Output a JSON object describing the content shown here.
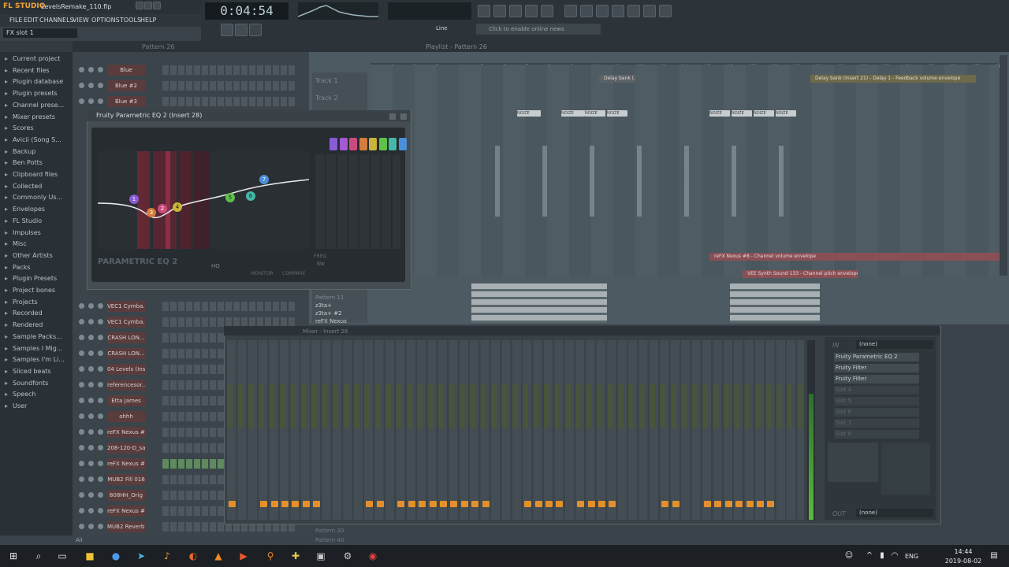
{
  "app": {
    "logo": "FL STUDIO",
    "filename": "LevelsRemake_110.flp",
    "hint": "FX slot 1"
  },
  "menu": [
    {
      "id": "file",
      "label": "FILE"
    },
    {
      "id": "edit",
      "label": "EDIT"
    },
    {
      "id": "channels",
      "label": "CHANNELS"
    },
    {
      "id": "view",
      "label": "VIEW"
    },
    {
      "id": "options",
      "label": "OPTIONS"
    },
    {
      "id": "tools",
      "label": "TOOLS"
    },
    {
      "id": "help",
      "label": "HELP"
    }
  ],
  "transport": {
    "time": "0:04:54",
    "snap": "Line",
    "news": "Click to enable online news"
  },
  "browser": {
    "items": [
      "Current project",
      "Recent files",
      "Plugin database",
      "Plugin presets",
      "Channel prese...",
      "Mixer presets",
      "Scores",
      "Avicii (Song S...",
      "Backup",
      "Ben Potts",
      "Clipboard files",
      "Collected",
      "Commonly Us...",
      "Envelopes",
      "FL Studio",
      "Impulses",
      "Misc",
      "Other Artists",
      "Packs",
      "Plugin Presets",
      "Project bones",
      "Projects",
      "Recorded",
      "Rendered",
      "Sample Packs...",
      "Samples I Mig...",
      "Samples I'm Li...",
      "Sliced beats",
      "Soundfonts",
      "Speech",
      "User"
    ],
    "footer": "All"
  },
  "rack": {
    "title": "Pattern 26",
    "filter": "All",
    "channels": [
      "Blue",
      "Blue #2",
      "Blue #3",
      "VEC1 Cymba...",
      "VEC1 Cymba...",
      "CRASH LON...",
      "CRASH LON...",
      "04 Levels (Ins...",
      "referencesor...",
      "Etta James",
      "ohhh",
      "reFX Nexus #7",
      "208-120-D_sa...",
      "reFX Nexus #8",
      "MUB2 Fill 016",
      "808HH_Orig",
      "reFX Nexus #6",
      "MUB2 Reverb..."
    ]
  },
  "playlist": {
    "title": "Playlist - Pattern 26",
    "tracks": [
      "Track 1",
      "Track 2"
    ],
    "lower_tracks": [
      "Pattern 11",
      "z3ta+",
      "z3ta+ #2",
      "reFX Nexus"
    ],
    "bottom_tracks": [
      "Pattern 30",
      "Pattern 40"
    ],
    "clips": {
      "delay1": "Delay bank (...",
      "delay2": "Delay bank (Insert 21) - Delay 1 - Feedback volume envelope",
      "noize": "NOIZE",
      "nexus_env": "reFX Nexus #8 - Channel volume envelope",
      "vee_env": "VEE Synth Sound 133 - Channel pitch envelope"
    },
    "ruler": [
      "1",
      "2",
      "3",
      "4",
      "5",
      "6",
      "7",
      "8",
      "9",
      "10",
      "11",
      "12",
      "13",
      "14",
      "15",
      "16",
      "17",
      "18",
      "19",
      "20",
      "21",
      "22",
      "23",
      "24",
      "25",
      "26",
      "27",
      "28"
    ]
  },
  "eq": {
    "title": "Fruity Parametric EQ 2 (Insert 28)",
    "label": "PARAMETRIC EQ 2",
    "hq": "HQ",
    "monitor": "MONITOR",
    "compare": "COMPARE",
    "freq": "FREQ",
    "bw": "BW",
    "bands": [
      "1",
      "2",
      "3",
      "4",
      "5",
      "6",
      "7"
    ],
    "band_colors": [
      "#8a5bd6",
      "#a45ad3",
      "#cc4b7f",
      "#d47d3e",
      "#c8b53a",
      "#5ec24a",
      "#45b8a9",
      "#4a8fd8"
    ]
  },
  "mixer": {
    "title": "Mixer - Insert 28",
    "in_label": "IN",
    "in_value": "(none)",
    "out_label": "OUT",
    "out_value": "(none)",
    "slots": [
      "Fruity Parametric EQ 2",
      "Fruity Filter",
      "Fruity Filter",
      "Slot 4",
      "Slot 5",
      "Slot 6",
      "Slot 7",
      "Slot 8"
    ]
  },
  "taskbar": {
    "lang": "ENG",
    "time": "14:44",
    "date": "2019-08-02"
  }
}
